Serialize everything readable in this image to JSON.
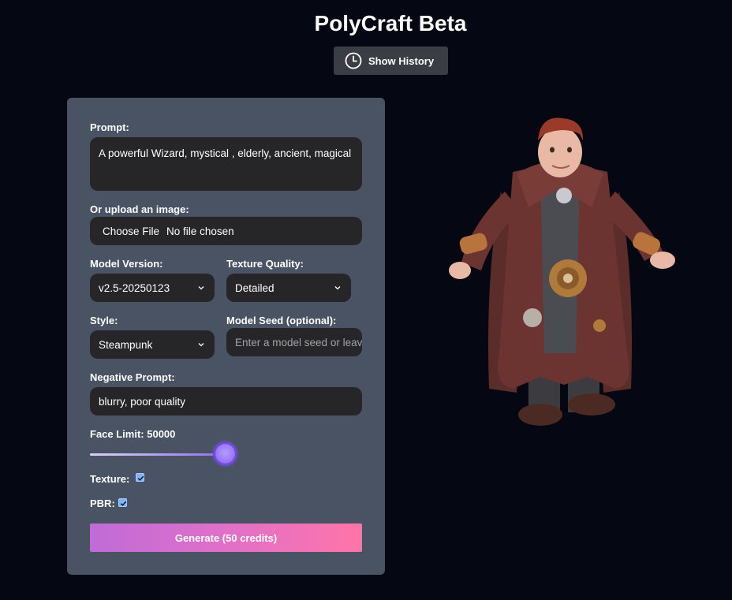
{
  "app": {
    "title": "PolyCraft Beta"
  },
  "header": {
    "history_button_label": "Show History",
    "history_icon": "clock-icon"
  },
  "form": {
    "prompt_label": "Prompt:",
    "prompt_value": "A powerful Wizard, mystical , elderly, ancient, magical",
    "upload_label": "Or upload an image:",
    "upload_button": "Choose File",
    "upload_status": "No file chosen",
    "model_version_label": "Model Version:",
    "model_version_value": "v2.5-20250123",
    "texture_quality_label": "Texture Quality:",
    "texture_quality_value": "Detailed",
    "style_label": "Style:",
    "style_value": "Steampunk",
    "seed_label": "Model Seed (optional):",
    "seed_placeholder": "Enter a model seed or leave blank",
    "negative_prompt_label": "Negative Prompt:",
    "negative_prompt_value": "blurry, poor quality",
    "face_limit_label": "Face Limit: 50000",
    "face_limit_value": 50000,
    "face_limit_fraction": 1.0,
    "texture_label": "Texture:",
    "texture_checked": true,
    "pbr_label": "PBR:",
    "pbr_checked": true,
    "generate_label": "Generate (50 credits)"
  },
  "preview": {
    "subject": "steampunk wizard character model"
  },
  "colors": {
    "background": "#050812",
    "panel": "#4a5363",
    "field": "#262628",
    "accent_start": "#c06bd8",
    "accent_end": "#ff75a8",
    "slider": "#8c6ff0"
  }
}
